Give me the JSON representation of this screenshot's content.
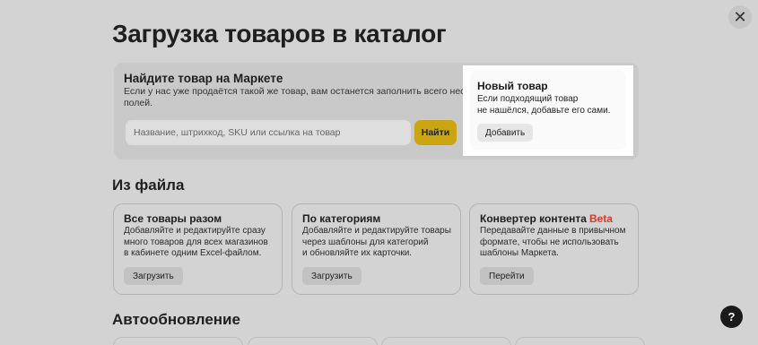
{
  "page": {
    "title": "Загрузка товаров в каталог"
  },
  "search_panel": {
    "title": "Найдите товар на Маркете",
    "description_line1": "Если у нас уже продаётся такой же товар, вам останется заполнить всего несколько",
    "description_line2": "полей.",
    "input_placeholder": "Название, штрихкод, SKU или ссылка на товар",
    "input_value": "",
    "button_label": "Найти"
  },
  "new_item": {
    "title": "Новый товар",
    "description_line1": "Если подходящий товар",
    "description_line2": "не нашёлся, добавьте его сами.",
    "button_label": "Добавить"
  },
  "from_file": {
    "title": "Из файла",
    "cards": [
      {
        "title": "Все товары разом",
        "beta": "",
        "lines": [
          "Добавляйте и редактируйте сразу",
          "много товаров для всех магазинов",
          "в кабинете одним Excel-файлом."
        ],
        "button": "Загрузить"
      },
      {
        "title": "По категориям",
        "beta": "",
        "lines": [
          "Добавляйте и редактируйте товары",
          "через шаблоны для категорий",
          "и обновляйте их карточки."
        ],
        "button": "Загрузить"
      },
      {
        "title": "Конвертер контента",
        "beta": "Beta",
        "lines": [
          "Передавайте данные в привычном",
          "формате, чтобы не использовать",
          "шаблоны Маркета."
        ],
        "button": "Перейти"
      }
    ]
  },
  "auto_update": {
    "title": "Автообновление"
  },
  "icons": {
    "close": "close-icon",
    "help": "help-icon"
  },
  "colors": {
    "find_button": "#c9a512",
    "beta": "#d83a2a",
    "help_button": "#1a1a1a"
  }
}
